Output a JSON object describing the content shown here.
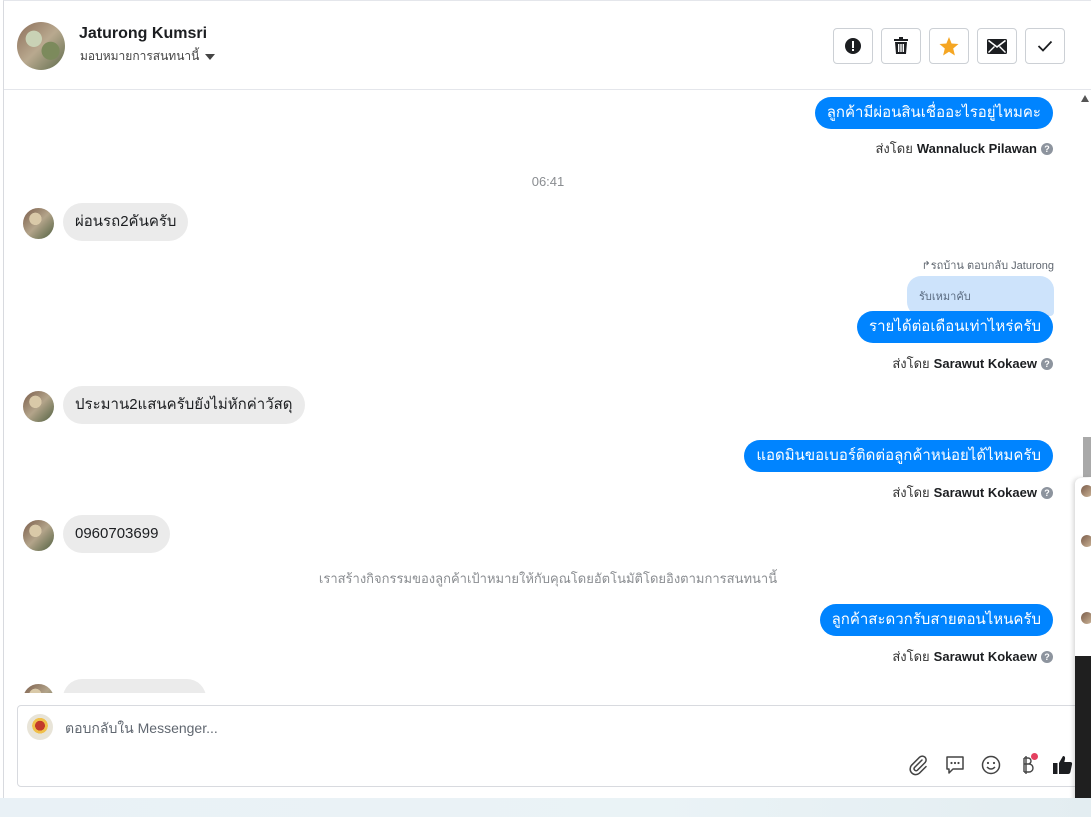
{
  "header": {
    "contact_name": "Jaturong Kumsri",
    "assign_label": "มอบหมายการสนทนานี้",
    "actions": [
      "spam-icon",
      "trash-icon",
      "star-icon",
      "envelope-icon",
      "check-icon"
    ],
    "star_color": "#f5a623"
  },
  "messages": [
    {
      "type": "outgoing",
      "text": "ลูกค้ามีผ่อนสินเชื่ออะไรอยู่ไหมคะ",
      "sent_by_prefix": "ส่งโดย",
      "sent_by": "Wannaluck Pilawan"
    },
    {
      "type": "timestamp",
      "text": "06:41"
    },
    {
      "type": "incoming",
      "text": "ผ่อนรถ2คันครับ"
    },
    {
      "type": "reply_context",
      "meta": "รถบ้าน ตอบกลับ Jaturong",
      "quoted": "รับเหมาคับ"
    },
    {
      "type": "outgoing",
      "text": "รายได้ต่อเดือนเท่าไหร่ครับ",
      "sent_by_prefix": "ส่งโดย",
      "sent_by": "Sarawut Kokaew"
    },
    {
      "type": "incoming",
      "text": "ประมาน2แสนครับยังไม่หักค่าวัสดุ"
    },
    {
      "type": "outgoing",
      "text": "แอดมินขอเบอร์ติดต่อลูกค้าหน่อยได้ไหมครับ",
      "sent_by_prefix": "ส่งโดย",
      "sent_by": "Sarawut Kokaew"
    },
    {
      "type": "incoming",
      "text": "0960703699"
    },
    {
      "type": "system",
      "text": "เราสร้างกิจกรรมของลูกค้าเป้าหมายให้กับคุณโดยอัตโนมัติโดยอิงตามการสนทนานี้"
    },
    {
      "type": "outgoing",
      "text": "ลูกค้าสะดวกรับสายตอนไหนครับ",
      "sent_by_prefix": "ส่งโดย",
      "sent_by": "Sarawut Kokaew"
    }
  ],
  "composer": {
    "placeholder": "ตอบกลับใน Messenger...",
    "icons": [
      "paperclip-icon",
      "saved-reply-icon",
      "emoji-icon",
      "baht-icon",
      "like-icon"
    ]
  },
  "colors": {
    "outgoing_bubble": "#0084ff",
    "incoming_bubble": "#ebebeb",
    "quoted_bubble": "#cde3fb"
  }
}
